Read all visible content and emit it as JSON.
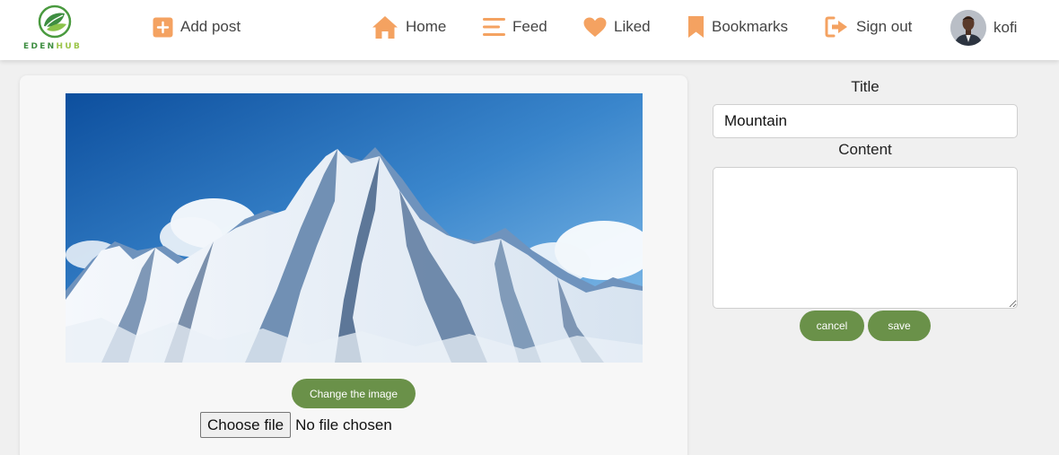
{
  "brand": {
    "name_part1": "EDEN",
    "name_part2": "HUB"
  },
  "nav": {
    "add_post": "Add post",
    "home": "Home",
    "feed": "Feed",
    "liked": "Liked",
    "bookmarks": "Bookmarks",
    "sign_out": "Sign out",
    "user_name": "kofi"
  },
  "icons": {
    "add_post": "plus-square-icon",
    "home": "house-icon",
    "feed": "hamburger-lines-icon",
    "liked": "heart-icon",
    "bookmarks": "bookmark-icon",
    "sign_out": "sign-out-arrow-icon"
  },
  "post_editor": {
    "change_image_label": "Change the image",
    "choose_file_label": "Choose file",
    "file_status": "No file chosen"
  },
  "form": {
    "title_label": "Title",
    "title_value": "Mountain",
    "content_label": "Content",
    "content_value": "",
    "cancel_label": "cancel",
    "save_label": "save"
  },
  "colors": {
    "accent_orange": "#f4a261",
    "button_green": "#6a9149",
    "logo_green": "#3e8e41",
    "logo_lime": "#9cc54a"
  }
}
